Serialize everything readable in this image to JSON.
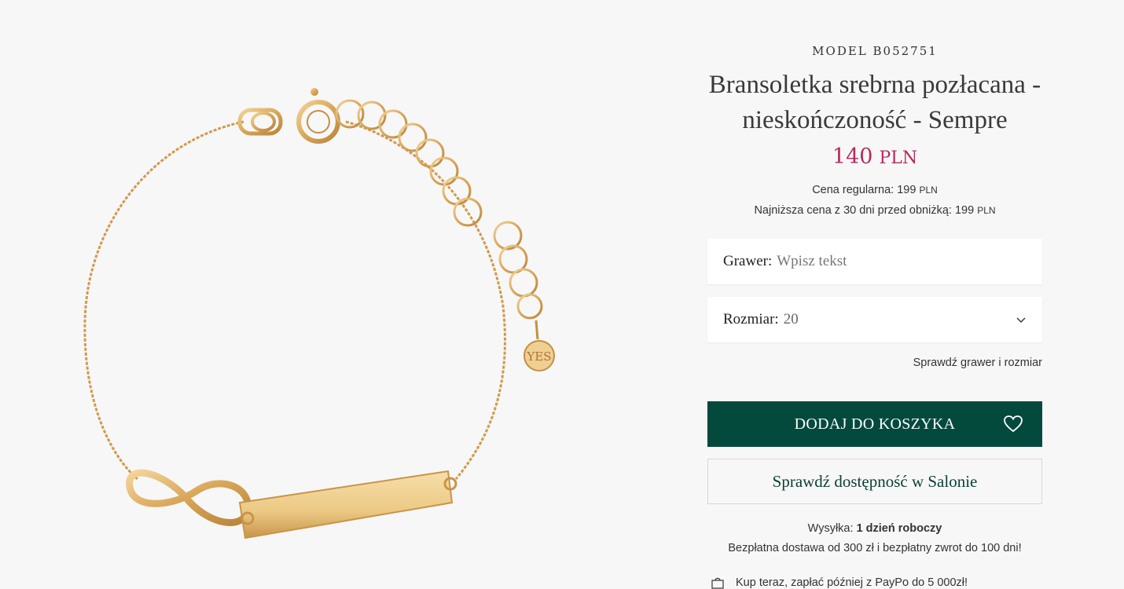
{
  "product": {
    "model": "MODEL B052751",
    "title": "Bransoletka srebrna pozłacana - nieskończoność - Sempre",
    "price_amount": "140",
    "price_currency": "PLN",
    "regular_price_label": "Cena regularna:",
    "regular_price_value": "199",
    "regular_price_currency": "PLN",
    "lowest_price_label": "Najniższa cena z 30 dni przed obniżką:",
    "lowest_price_value": "199",
    "lowest_price_currency": "PLN",
    "image_alt": "Bransoletka srebrna pozłacana - nieskończoność"
  },
  "form": {
    "engraving_label": "Grawer:",
    "engraving_placeholder": "Wpisz tekst",
    "size_label": "Rozmiar:",
    "size_value": "20",
    "check_link": "Sprawdź grawer i rozmiar"
  },
  "actions": {
    "add_to_cart": "DODAJ DO KOSZYKA",
    "check_availability": "Sprawdź dostępność w Salonie"
  },
  "shipping": {
    "label": "Wysyłka:",
    "value": "1 dzień roboczy",
    "delivery_info": "Bezpłatna dostawa od 300 zł i bezpłatny zwrot do 100 dni!",
    "paypo": "Kup teraz, zapłać później z PayPo do 5 000zł!"
  },
  "colors": {
    "price": "#b62a5e",
    "primary_button": "#034a3d",
    "background": "#f7f7f7",
    "gold": "#d9a85a"
  },
  "icons": [
    "chevron-down-icon",
    "heart-icon",
    "shopping-bag-icon"
  ]
}
